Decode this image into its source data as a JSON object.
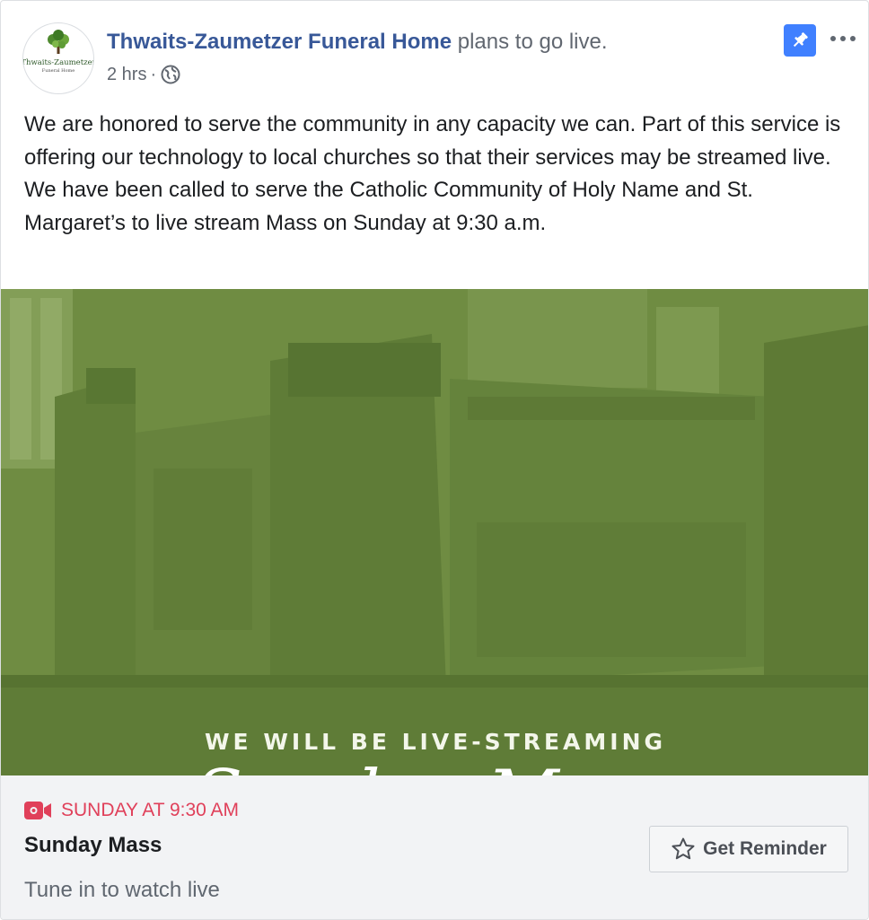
{
  "post": {
    "page_name": "Thwaits-Zaumetzer Funeral Home",
    "action_text": " plans to go live.",
    "time": "2 hrs",
    "separator": "·",
    "privacy_icon": "globe-icon",
    "avatar_logo_text": "Thwaits-Zaumetzer",
    "avatar_logo_sub": "Funeral Home",
    "body": [
      "We are honored to serve the community in any capacity we can. Part of this service is offering our technology to local churches so that their services may be streamed live.",
      "We have been called to serve the Catholic Community of Holy Name and St. Margaret’s to live stream Mass on Sunday at 9:30 a.m."
    ],
    "pin_icon": "pin-icon",
    "more_icon": "more-options-icon"
  },
  "media": {
    "caption": "WE WILL BE LIVE-STREAMING",
    "script_title": "Sunday Mass",
    "overlay_color": "#6f8d42"
  },
  "event": {
    "time_label": "SUNDAY AT 9:30 AM",
    "title": "Sunday Mass",
    "subtitle": "Tune in to watch live",
    "reminder_label": "Get Reminder",
    "accent_color": "#e0405a"
  }
}
